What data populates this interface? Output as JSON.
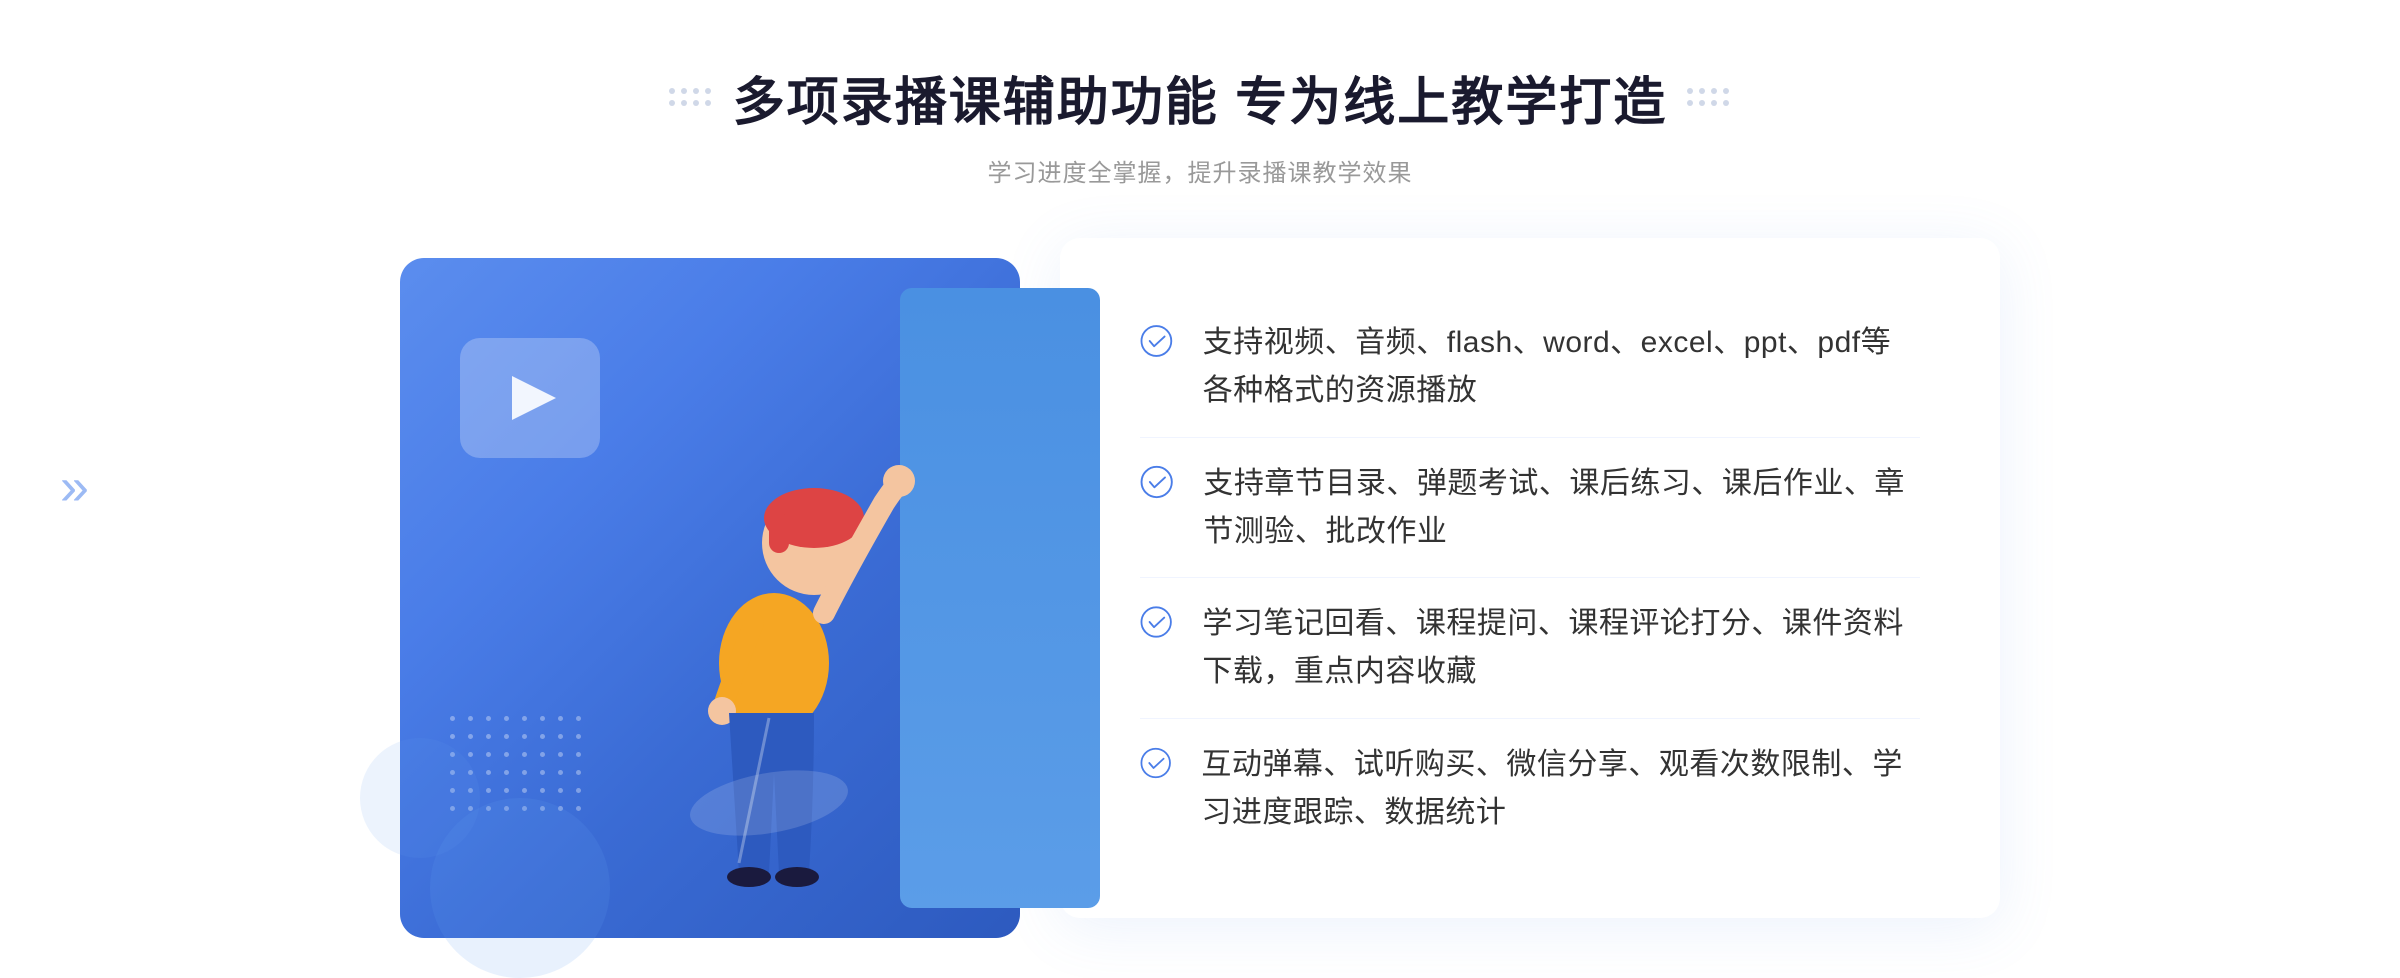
{
  "header": {
    "main_title": "多项录播课辅助功能 专为线上教学打造",
    "subtitle": "学习进度全掌握，提升录播课教学效果"
  },
  "features": [
    {
      "id": "feature-1",
      "text": "支持视频、音频、flash、word、excel、ppt、pdf等各种格式的资源播放"
    },
    {
      "id": "feature-2",
      "text": "支持章节目录、弹题考试、课后练习、课后作业、章节测验、批改作业"
    },
    {
      "id": "feature-3",
      "text": "学习笔记回看、课程提问、课程评论打分、课件资料下载，重点内容收藏"
    },
    {
      "id": "feature-4",
      "text": "互动弹幕、试听购买、微信分享、观看次数限制、学习进度跟踪、数据统计"
    }
  ],
  "colors": {
    "primary": "#4a7de8",
    "primary_dark": "#2d5abf",
    "check_color": "#4a7de8",
    "title_color": "#1a1a2e",
    "text_color": "#333333",
    "subtitle_color": "#999999"
  }
}
